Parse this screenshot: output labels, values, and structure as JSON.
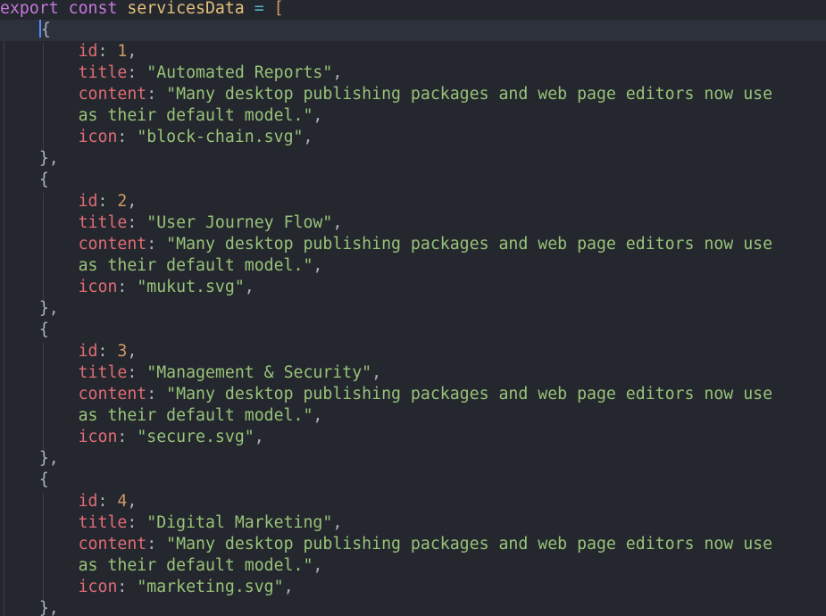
{
  "editor": {
    "header": {
      "kw_export": "export",
      "kw_const": "const",
      "name": "servicesData",
      "assign": "=",
      "bracket_open": "["
    },
    "punct": {
      "open_brace": "{",
      "close_brace": "},",
      "comma": ",",
      "colon": ":"
    },
    "keys": {
      "id": "id",
      "title": "title",
      "content": "content",
      "icon": "icon"
    },
    "items": [
      {
        "id": "1",
        "title": "\"Automated Reports\"",
        "content_line1": "\"Many desktop publishing packages and web page editors now use",
        "content_line2": "as their default model.\"",
        "icon": "\"block-chain.svg\""
      },
      {
        "id": "2",
        "title": "\"User Journey Flow\"",
        "content_line1": "\"Many desktop publishing packages and web page editors now use",
        "content_line2": "as their default model.\"",
        "icon": "\"mukut.svg\""
      },
      {
        "id": "3",
        "title": "\"Management & Security\"",
        "content_line1": "\"Many desktop publishing packages and web page editors now use",
        "content_line2": "as their default model.\"",
        "icon": "\"secure.svg\""
      },
      {
        "id": "4",
        "title": "\"Digital Marketing\"",
        "content_line1": "\"Many desktop publishing packages and web page editors now use",
        "content_line2": "as their default model.\"",
        "icon": "\"marketing.svg\""
      }
    ],
    "colors": {
      "background": "#24272e",
      "active_line": "#2c313c",
      "keyword": "#c678dd",
      "identifier": "#e5c07b",
      "property": "#e06c75",
      "number": "#d19a66",
      "string": "#98c379"
    }
  }
}
